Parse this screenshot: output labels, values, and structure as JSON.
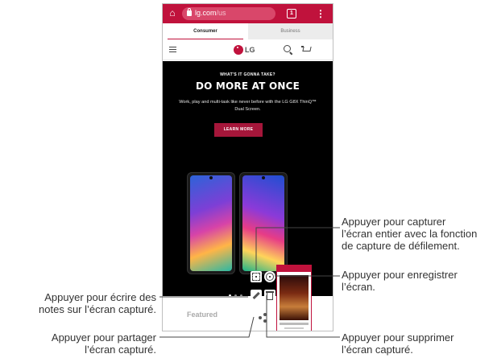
{
  "browser": {
    "url_host": "lg.com",
    "url_path": "/us",
    "tab_count": "1"
  },
  "segment_tabs": {
    "consumer": "Consumer",
    "business": "Business"
  },
  "site_header": {
    "logo_text": "LG"
  },
  "hero": {
    "kicker": "WHAT'S IT GONNA TAKE?",
    "headline": "DO MORE AT ONCE",
    "description": "Work, play and multi-task like never before with the LG G8X ThinQ™ Dual Screen.",
    "cta_label": "LEARN MORE"
  },
  "featured": {
    "title": "Featured"
  },
  "callouts": {
    "scroll_capture": [
      "Appuyer pour capturer",
      "l’écran entier avec la fonction",
      "de capture de défilement."
    ],
    "record": [
      "Appuyer pour enregistrer",
      "l’écran."
    ],
    "draw": [
      "Appuyer pour écrire des",
      "notes sur l’écran capturé."
    ],
    "share": [
      "Appuyer pour partager",
      "l’écran capturé."
    ],
    "delete": [
      "Appuyer pour supprimer",
      "l’écran capturé."
    ]
  },
  "colors": {
    "accent": "#c0123c",
    "hero_background": "#000000",
    "cta": "#a5163a"
  }
}
